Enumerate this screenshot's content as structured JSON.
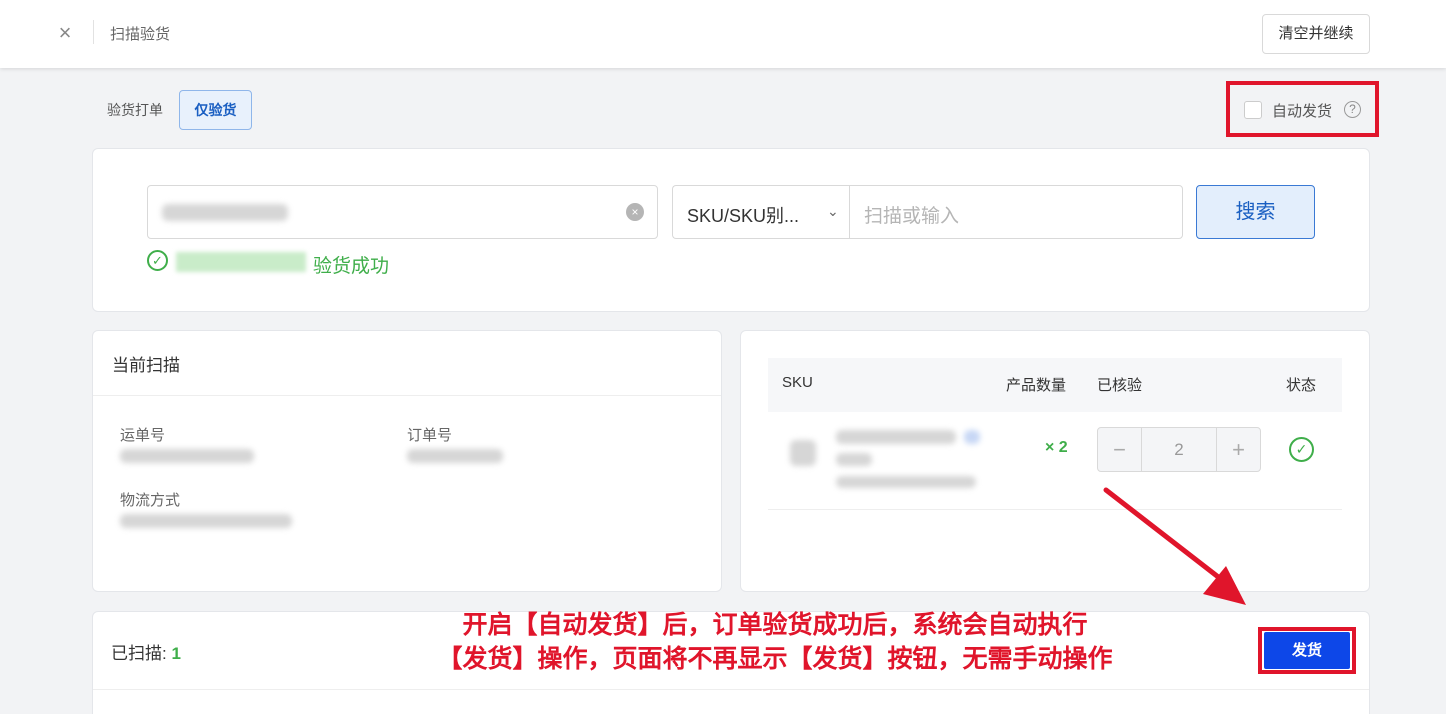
{
  "header": {
    "title": "扫描验货",
    "clear_button": "清空并继续"
  },
  "mode": {
    "label": "验货打单",
    "active_button": "仅验货"
  },
  "auto_ship": {
    "label": "自动发货",
    "checked": false,
    "help_icon": "question-circle-icon"
  },
  "search": {
    "select_value": "SKU/SKU别...",
    "input_placeholder": "扫描或输入",
    "button": "搜索",
    "success_text": "验货成功"
  },
  "current_scan": {
    "title": "当前扫描",
    "fields": {
      "tracking_label": "运单号",
      "order_label": "订单号",
      "logistics_label": "物流方式"
    }
  },
  "sku_table": {
    "columns": [
      "SKU",
      "产品数量",
      "已核验",
      "状态"
    ],
    "rows": [
      {
        "quantity": "× 2",
        "verified": "2",
        "status_icon": "check-circle-icon"
      }
    ]
  },
  "scanned": {
    "label": "已扫描:",
    "count": "1"
  },
  "annotation": {
    "line1": "开启【自动发货】后，订单验货成功后，系统会自动执行",
    "line2": "【发货】操作，页面将不再显示【发货】按钮，无需手动操作"
  },
  "ship_button": "发货",
  "colors": {
    "accent_blue": "#0d47e8",
    "success_green": "#3fae4a",
    "annotation_red": "#e0152b"
  }
}
